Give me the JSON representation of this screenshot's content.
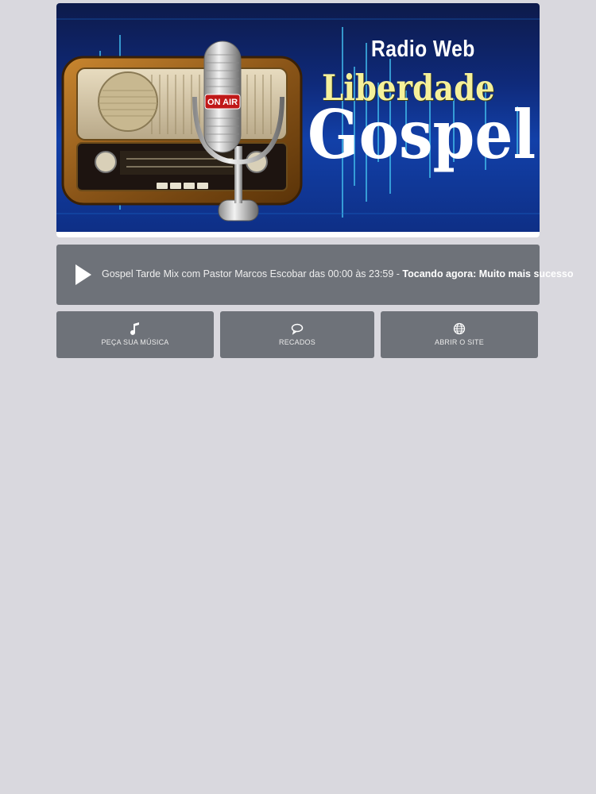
{
  "banner": {
    "radio_web": "Radio Web",
    "liberdade": "Liberdade",
    "gospel": "Gospel",
    "on_air": "ON AIR"
  },
  "player": {
    "program": "Gospel Tarde Mix com Pastor Marcos Escobar das 00:00 às 23:59 - ",
    "now_playing": "Tocando agora: Muito mais sucesso",
    "play_icon": "play-icon"
  },
  "actions": [
    {
      "label": "PEÇA SUA MÚSICA",
      "icon": "music-note-icon"
    },
    {
      "label": "RECADOS",
      "icon": "speech-bubble-icon"
    },
    {
      "label": "ABRIR O SITE",
      "icon": "globe-icon"
    }
  ],
  "colors": {
    "background": "#d9d8de",
    "panel": "#6e7279",
    "title_yellow": "#f5f09a"
  }
}
